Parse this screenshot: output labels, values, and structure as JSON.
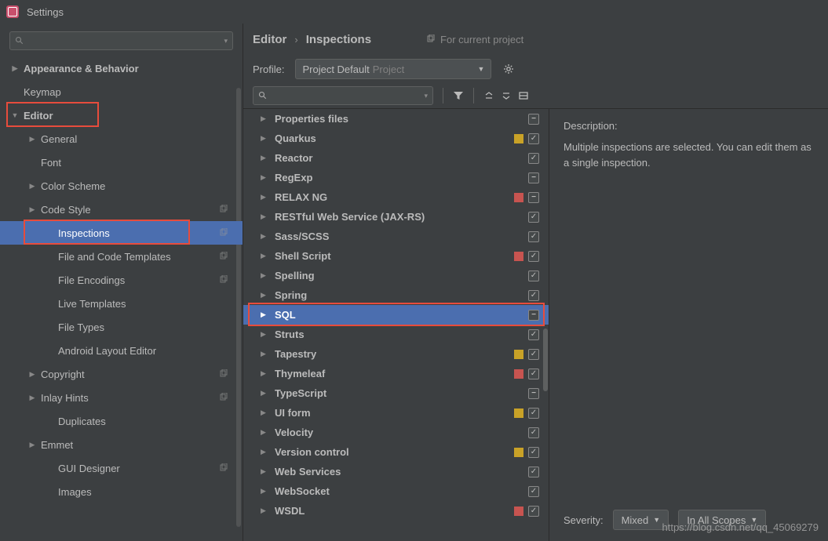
{
  "window": {
    "title": "Settings"
  },
  "breadcrumb": {
    "a": "Editor",
    "b": "Inspections",
    "for_project": "For current project"
  },
  "profile": {
    "label": "Profile:",
    "value": "Project Default",
    "scope": "Project"
  },
  "sidebar": {
    "items": [
      {
        "label": "Appearance & Behavior",
        "level": 0,
        "arrow": "right",
        "bold": true
      },
      {
        "label": "Keymap",
        "level": 0,
        "arrow": "none"
      },
      {
        "label": "Editor",
        "level": 0,
        "arrow": "down",
        "bold": true,
        "redbox": true
      },
      {
        "label": "General",
        "level": 1,
        "arrow": "right"
      },
      {
        "label": "Font",
        "level": 1,
        "arrow": "none"
      },
      {
        "label": "Color Scheme",
        "level": 1,
        "arrow": "right"
      },
      {
        "label": "Code Style",
        "level": 1,
        "arrow": "right",
        "copy": true
      },
      {
        "label": "Inspections",
        "level": 2,
        "arrow": "none",
        "selected": true,
        "copy": true,
        "redbox": true
      },
      {
        "label": "File and Code Templates",
        "level": 2,
        "arrow": "none",
        "copy": true
      },
      {
        "label": "File Encodings",
        "level": 2,
        "arrow": "none",
        "copy": true
      },
      {
        "label": "Live Templates",
        "level": 2,
        "arrow": "none"
      },
      {
        "label": "File Types",
        "level": 2,
        "arrow": "none"
      },
      {
        "label": "Android Layout Editor",
        "level": 2,
        "arrow": "none"
      },
      {
        "label": "Copyright",
        "level": 1,
        "arrow": "right",
        "copy": true
      },
      {
        "label": "Inlay Hints",
        "level": 1,
        "arrow": "right",
        "copy": true
      },
      {
        "label": "Duplicates",
        "level": 2,
        "arrow": "none"
      },
      {
        "label": "Emmet",
        "level": 1,
        "arrow": "right"
      },
      {
        "label": "GUI Designer",
        "level": 2,
        "arrow": "none",
        "copy": true
      },
      {
        "label": "Images",
        "level": 2,
        "arrow": "none"
      }
    ]
  },
  "inspections": {
    "items": [
      {
        "label": "Properties files",
        "cb": "partial"
      },
      {
        "label": "Quarkus",
        "swatch": "yellow",
        "cb": "checked"
      },
      {
        "label": "Reactor",
        "cb": "checked"
      },
      {
        "label": "RegExp",
        "cb": "partial"
      },
      {
        "label": "RELAX NG",
        "swatch": "red",
        "cb": "partial"
      },
      {
        "label": "RESTful Web Service (JAX-RS)",
        "cb": "checked"
      },
      {
        "label": "Sass/SCSS",
        "cb": "checked"
      },
      {
        "label": "Shell Script",
        "swatch": "red",
        "cb": "checked"
      },
      {
        "label": "Spelling",
        "cb": "checked"
      },
      {
        "label": "Spring",
        "cb": "checked"
      },
      {
        "label": "SQL",
        "cb": "partial",
        "selected": true,
        "redbox": true
      },
      {
        "label": "Struts",
        "cb": "checked"
      },
      {
        "label": "Tapestry",
        "swatch": "yellow",
        "cb": "checked"
      },
      {
        "label": "Thymeleaf",
        "swatch": "red",
        "cb": "checked"
      },
      {
        "label": "TypeScript",
        "cb": "partial"
      },
      {
        "label": "UI form",
        "swatch": "yellow",
        "cb": "checked"
      },
      {
        "label": "Velocity",
        "cb": "checked"
      },
      {
        "label": "Version control",
        "swatch": "yellow",
        "cb": "checked"
      },
      {
        "label": "Web Services",
        "cb": "checked"
      },
      {
        "label": "WebSocket",
        "cb": "checked"
      },
      {
        "label": "WSDL",
        "swatch": "red",
        "cb": "checked"
      }
    ]
  },
  "description": {
    "title": "Description:",
    "text": "Multiple inspections are selected. You can edit them as a single inspection."
  },
  "severity": {
    "label": "Severity:",
    "value": "Mixed",
    "scope": "In All Scopes"
  },
  "watermark": "https://blog.csdn.net/qq_45069279"
}
